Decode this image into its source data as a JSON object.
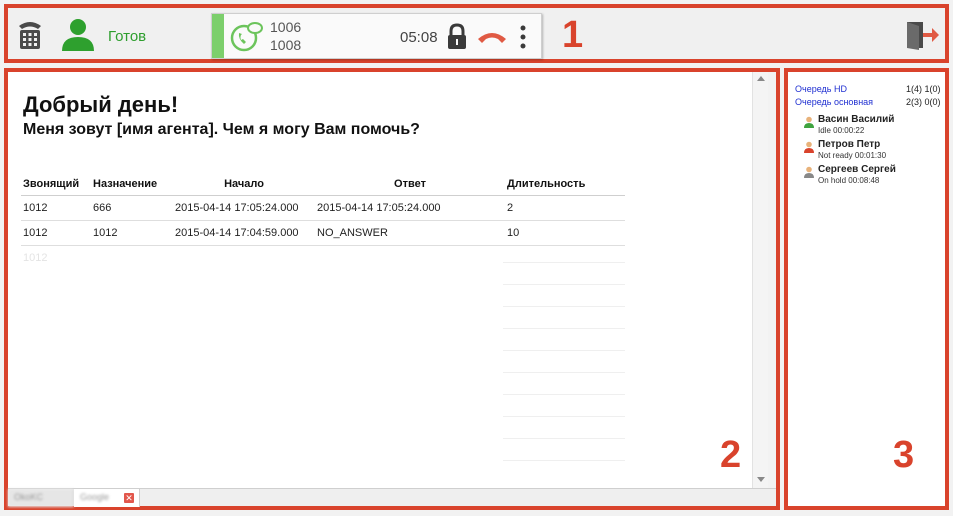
{
  "colors": {
    "annotation": "#d9432c",
    "status_ready": "#2e9e2e",
    "call_accent": "#7ccf6c",
    "hangup": "#e05a44",
    "queue_link": "#1f2fd1"
  },
  "annotations": [
    "1",
    "2",
    "3"
  ],
  "toolbar": {
    "dialpad_icon": "phone-keypad-icon",
    "agent_icon": "user-icon",
    "status": "Готов",
    "call": {
      "icon": "phone-chat-icon",
      "from": "1006",
      "to": "1008",
      "timer": "05:08",
      "lock_icon": "lock-icon",
      "hangup_icon": "hangup-icon",
      "more_icon": "vertical-dots-icon"
    },
    "logout_icon": "logout-icon"
  },
  "main": {
    "greeting": "Добрый день!",
    "subgreeting": "Меня зовут [имя агента]. Чем я могу Вам помочь?",
    "table": {
      "headers": [
        "Звонящий",
        "Назначение",
        "Начало",
        "Ответ",
        "Длительность"
      ],
      "rows": [
        [
          "1012",
          "666",
          "2015-04-14 17:05:24.000",
          "2015-04-14 17:05:24.000",
          "2"
        ],
        [
          "1012",
          "1012",
          "2015-04-14 17:04:59.000",
          "NO_ANSWER",
          "10"
        ],
        [
          "1012",
          "",
          "",
          "",
          ""
        ]
      ]
    },
    "tabs": [
      {
        "label": "OkoKC"
      },
      {
        "label": "Google"
      }
    ]
  },
  "side": {
    "queues": [
      {
        "name": "Очередь HD",
        "stat": "1(4) 1(0)"
      },
      {
        "name": "Очередь основная",
        "stat": "2(3) 0(0)"
      }
    ],
    "agents": [
      {
        "name": "Васин Василий",
        "status": "Idle 00:00:22",
        "color": "#3fa33f"
      },
      {
        "name": "Петров Петр",
        "status": "Not ready 00:01:30",
        "color": "#d9432c"
      },
      {
        "name": "Сергеев Сергей",
        "status": "On hold 00:08:48",
        "color": "#888888"
      }
    ]
  }
}
